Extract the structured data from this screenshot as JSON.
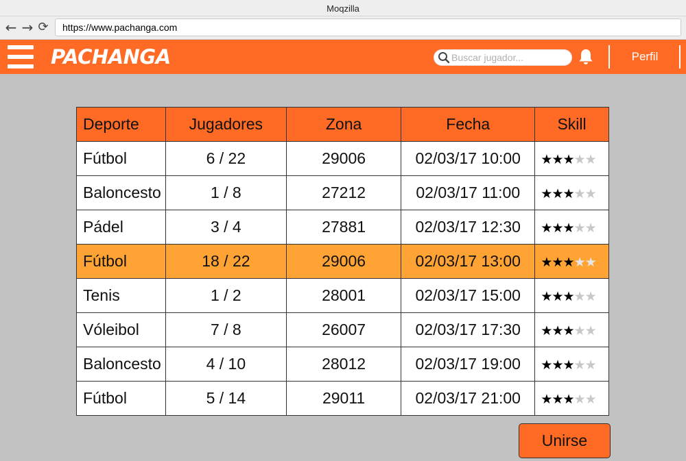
{
  "window": {
    "title": "Moqzilla"
  },
  "browser": {
    "url": "https://www.pachanga.com",
    "back_icon": "←",
    "forward_icon": "→",
    "reload_icon": "⟳"
  },
  "header": {
    "logo": "PACHANGA",
    "search_placeholder": "Buscar jugador...",
    "profile_label": "Perfil"
  },
  "colors": {
    "accent": "#ff6b24",
    "selected_row": "#ffa434",
    "background": "#c2c2c2"
  },
  "table": {
    "headers": [
      "Deporte",
      "Jugadores",
      "Zona",
      "Fecha",
      "Skill"
    ],
    "selected_index": 3,
    "rows": [
      {
        "sport": "Fútbol",
        "players": "6 / 22",
        "zone": "29006",
        "date": "02/03/17 10:00",
        "skill": 3,
        "skill_max": 5
      },
      {
        "sport": "Baloncesto",
        "players": "1 / 8",
        "zone": "27212",
        "date": "02/03/17 11:00",
        "skill": 3,
        "skill_max": 5
      },
      {
        "sport": "Pádel",
        "players": "3 / 4",
        "zone": "27881",
        "date": "02/03/17 12:30",
        "skill": 3,
        "skill_max": 5
      },
      {
        "sport": "Fútbol",
        "players": "18 / 22",
        "zone": "29006",
        "date": "02/03/17 13:00",
        "skill": 3,
        "skill_max": 5
      },
      {
        "sport": "Tenis",
        "players": "1 / 2",
        "zone": "28001",
        "date": "02/03/17 15:00",
        "skill": 3,
        "skill_max": 5
      },
      {
        "sport": "Vóleibol",
        "players": "7 / 8",
        "zone": "26007",
        "date": "02/03/17 17:30",
        "skill": 3,
        "skill_max": 5
      },
      {
        "sport": "Baloncesto",
        "players": "4 / 10",
        "zone": "28012",
        "date": "02/03/17 19:00",
        "skill": 3,
        "skill_max": 5
      },
      {
        "sport": "Fútbol",
        "players": "5 / 14",
        "zone": "29011",
        "date": "02/03/17 21:00",
        "skill": 3,
        "skill_max": 5
      }
    ]
  },
  "actions": {
    "join_label": "Unirse"
  }
}
